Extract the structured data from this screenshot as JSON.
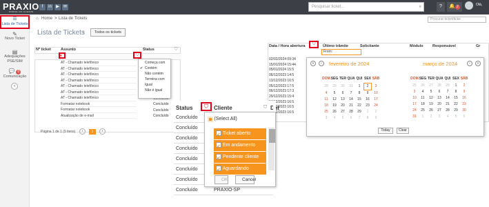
{
  "brand": {
    "logo": "PRAXIO",
    "subtitle": "PORTAL DO CLIENTE"
  },
  "top": {
    "social": [
      "f",
      "in",
      "▶",
      "✉"
    ],
    "search_placeholder": "Pesquisar ticket...",
    "help": "?",
    "notif_count": "2",
    "user": "Olá,"
  },
  "sidebar": {
    "items": [
      {
        "label": "Lista de Tickets"
      },
      {
        "label": "Novo Ticket"
      },
      {
        "label": "Adequações PSE/SIM"
      },
      {
        "label": "Comunicação",
        "badge": "0"
      }
    ]
  },
  "breadcrumb": {
    "home": "Home",
    "sep": ">",
    "current": "Lista de Tickets"
  },
  "right_search_placeholder": "Procurar ticket/ticke",
  "title": "Lista de Tickets",
  "all_button": "Todos os tickets",
  "grid": {
    "headers": [
      "Nº ticket",
      "Assunto",
      "Status"
    ],
    "rows": [
      {
        "assunto": "AT - Chamado telefônico",
        "status": ""
      },
      {
        "assunto": "AT - Chamado telefônico",
        "status": ""
      },
      {
        "assunto": "AT - Chamado telefônico",
        "status": ""
      },
      {
        "assunto": "AT - Chamado telefônico",
        "status": ""
      },
      {
        "assunto": "AT - Chamado telefônico",
        "status": ""
      },
      {
        "assunto": "AT - Chamado telefônico",
        "status": ""
      },
      {
        "assunto": "AT - Chamado telefônico",
        "status": "Concluído"
      },
      {
        "assunto": "Formatar notebook",
        "status": "Concluído"
      },
      {
        "assunto": "Formatar notebook",
        "status": "Concluído"
      },
      {
        "assunto": "Atualização de e-mail",
        "status": "Concluído"
      }
    ],
    "pager": "Página 1 de 1 (9 itens)",
    "page": "1"
  },
  "filter_menu": [
    "Começa com",
    "Contém",
    "Não contém",
    "Termina com",
    "Igual",
    "Não é igual"
  ],
  "grid2": {
    "headers": [
      "Data / Hora abertura",
      "Último trâmite",
      "Solicitante",
      "Módulo",
      "Responsável",
      "Gr"
    ],
    "dates": [
      "02/02/2024 09:34",
      "15/01/2024 15:44",
      "05/01/2024 15:5",
      "06/12/2023 14:5",
      "13/12/2023 16:5",
      "05/12/2023 17:5",
      "06/12/2023 17:3",
      "29/12/2023 15:4",
      "24/12/2023 16:5",
      "24/12/2023 16:5",
      "24/12/2023 16:5"
    ],
    "from_label": "From:"
  },
  "calendar": {
    "month1": "fevereiro de 2024",
    "month2": "março de 2024",
    "dow": [
      "DOM",
      "SEG",
      "TER",
      "QUA",
      "QUI",
      "SEX",
      "SÁB"
    ],
    "m1": [
      [
        "28",
        "29",
        "30",
        "31",
        "1",
        "2",
        "3"
      ],
      [
        "4",
        "5",
        "6",
        "7",
        "8",
        "9",
        "10"
      ],
      [
        "11",
        "12",
        "13",
        "14",
        "15",
        "16",
        "17"
      ],
      [
        "18",
        "19",
        "20",
        "21",
        "22",
        "23",
        "24"
      ],
      [
        "25",
        "26",
        "27",
        "28",
        "29",
        "1",
        "2"
      ],
      [
        "3",
        "4",
        "5",
        "6",
        "7",
        "8",
        "9"
      ]
    ],
    "m2": [
      [
        "25",
        "26",
        "27",
        "28",
        "29",
        "1",
        "2"
      ],
      [
        "3",
        "4",
        "5",
        "6",
        "7",
        "8",
        "9"
      ],
      [
        "10",
        "11",
        "12",
        "13",
        "14",
        "15",
        "16"
      ],
      [
        "17",
        "18",
        "19",
        "20",
        "21",
        "22",
        "23"
      ],
      [
        "24",
        "25",
        "26",
        "27",
        "28",
        "29",
        "30"
      ],
      [
        "31",
        "1",
        "2",
        "3",
        "4",
        "5",
        "6"
      ]
    ],
    "today": "Today",
    "clear": "Clear"
  },
  "zoom": {
    "headers": [
      "Status",
      "Cliente",
      "Dat"
    ],
    "statuses": [
      "Concluído",
      "Concluído",
      "Concluído",
      "Concluído",
      "Concluído",
      "Concluído",
      "Concluído",
      "Concluído"
    ],
    "clients": [
      "",
      "",
      "",
      "",
      "",
      "",
      "",
      "PRAXIO-SP"
    ],
    "options": [
      {
        "label": "(Select All)",
        "checked": true
      },
      {
        "label": "Ticket aberto",
        "checked": true
      },
      {
        "label": "Em andamento",
        "checked": true
      },
      {
        "label": "Pendente cliente",
        "checked": true
      },
      {
        "label": "Aguardando adequação",
        "checked": true
      }
    ],
    "ok": "OK",
    "cancel": "Cancel"
  }
}
